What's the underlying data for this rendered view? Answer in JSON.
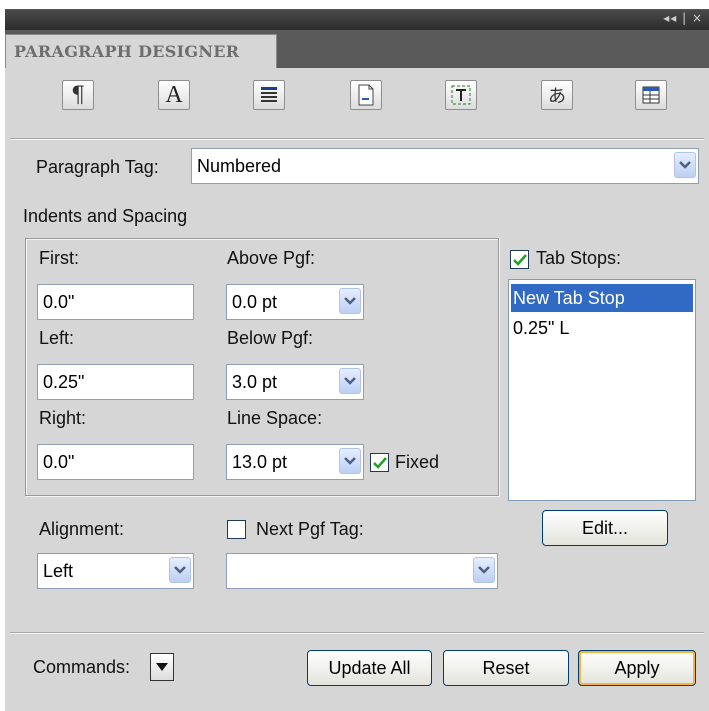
{
  "window": {
    "controls": "◂◂ | ×",
    "tab_title": "PARAGRAPH DESIGNER"
  },
  "toolbar": {
    "icons": [
      "basic-properties-icon",
      "default-font-icon",
      "pagination-icon",
      "numbering-icon",
      "advanced-icon",
      "asian-icon",
      "table-cell-icon"
    ],
    "glyph_basic": "¶",
    "glyph_font": "A",
    "glyph_asian": "あ"
  },
  "paragraph_tag": {
    "label": "Paragraph Tag:",
    "value": "Numbered"
  },
  "indents": {
    "section_label": "Indents and Spacing",
    "first_label": "First:",
    "first_value": "0.0\"",
    "left_label": "Left:",
    "left_value": "0.25\"",
    "right_label": "Right:",
    "right_value": "0.0\"",
    "above_label": "Above Pgf:",
    "above_value": "0.0 pt",
    "below_label": "Below Pgf:",
    "below_value": "3.0 pt",
    "line_space_label": "Line Space:",
    "line_space_value": "13.0 pt",
    "fixed_label": "Fixed",
    "fixed_checked": true
  },
  "tab_stops": {
    "label": "Tab Stops:",
    "checked": true,
    "items": [
      "New Tab Stop",
      "0.25\"  L"
    ],
    "selected_index": 0,
    "edit_label": "Edit..."
  },
  "alignment": {
    "label": "Alignment:",
    "value": "Left"
  },
  "next_pgf": {
    "label": "Next Pgf Tag:",
    "checked": false,
    "value": ""
  },
  "footer": {
    "commands_label": "Commands:",
    "update_all_label": "Update All",
    "reset_label": "Reset",
    "apply_label": "Apply"
  },
  "colors": {
    "selection": "#316ac5",
    "check": "#21a121",
    "dropdown_arrow": "#4d6185",
    "default_button_ring": "#f8b33c"
  }
}
